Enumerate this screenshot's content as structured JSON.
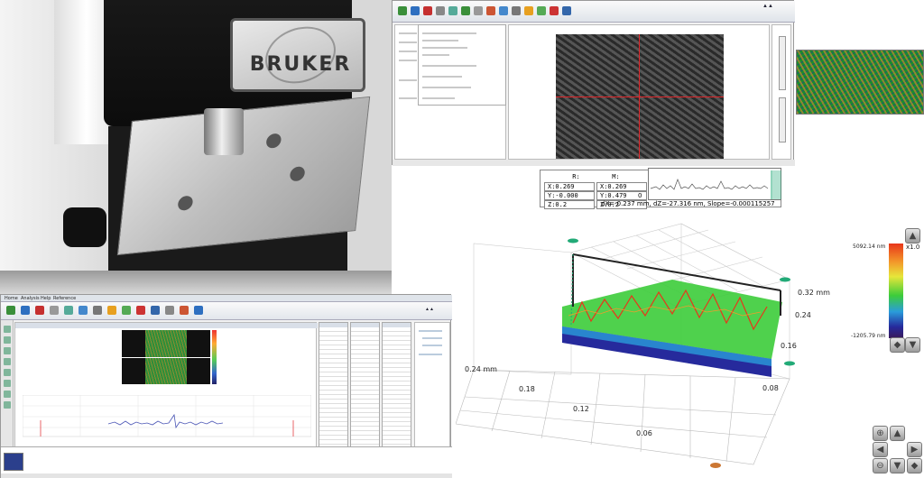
{
  "photo": {
    "brand": "BRUKER"
  },
  "readout": {
    "r_label": "R:",
    "m_label": "M:",
    "rx": "X:0.269",
    "ry": "Y:-0.000",
    "rz": "Z:0.2",
    "mx": "X:0.269",
    "my": "Y:0.479",
    "mz": "Z:0.2",
    "profile_zero_top": "0",
    "profile_zero_bottom": "0",
    "measure": "dX=-0.237 mm, dZ=-27.316 nm, Slope=-0.000115257"
  },
  "plot3d": {
    "x_ticks": [
      "0.24 mm",
      "0.18",
      "0.12",
      "0.06"
    ],
    "y_ticks": [
      "0.32 mm",
      "0.24",
      "0.16",
      "0.08"
    ]
  },
  "colorbar": {
    "max_label": "5092.14 nm",
    "min_label": "-1205.79 nm",
    "scale_label": "x1.0"
  },
  "window2": {
    "tabs": [
      "Home",
      "Analysis",
      "Help",
      "Reference"
    ]
  },
  "colors": {
    "crosshair": "#e0262a",
    "surface_high": "#e8361a",
    "surface_mid": "#3ccc3a",
    "surface_low": "#262a9c"
  }
}
